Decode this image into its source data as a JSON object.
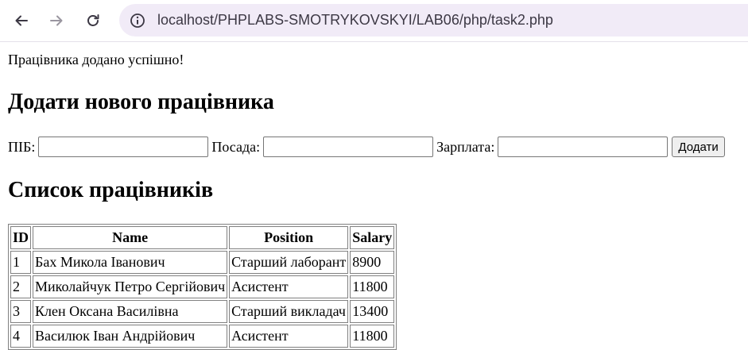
{
  "browser": {
    "url": "localhost/PHPLABS-SMOTRYKOVSKYI/LAB06/php/task2.php",
    "back_icon": "arrow-left-icon",
    "forward_icon": "arrow-right-icon",
    "reload_icon": "reload-icon",
    "info_icon": "site-info-icon"
  },
  "page": {
    "success_message": "Працівника додано успішно!",
    "add_heading": "Додати нового працівника",
    "form": {
      "name_label": "ПІБ:",
      "name_value": "",
      "position_label": "Посада:",
      "position_value": "",
      "salary_label": "Зарплата:",
      "salary_value": "",
      "submit_label": "Додати"
    },
    "list_heading": "Список працівників",
    "table": {
      "headers": [
        "ID",
        "Name",
        "Position",
        "Salary"
      ],
      "rows": [
        [
          "1",
          "Бах Микола Іванович",
          "Старший лаборант",
          "8900"
        ],
        [
          "2",
          "Миколайчук Петро Сергійович",
          "Асистент",
          "11800"
        ],
        [
          "3",
          "Клен Оксана Василівна",
          "Старший викладач",
          "13400"
        ],
        [
          "4",
          "Василюк Іван Андрійович",
          "Асистент",
          "11800"
        ]
      ]
    }
  }
}
